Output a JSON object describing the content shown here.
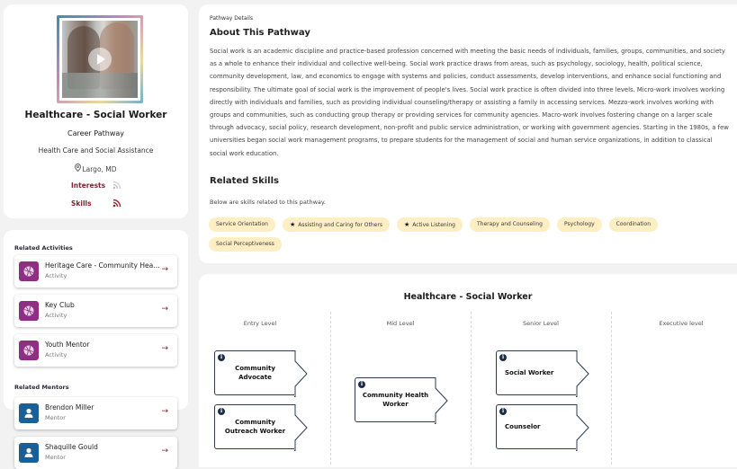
{
  "profile": {
    "photo_alt": "video thumbnail with play button",
    "title": "Healthcare - Social Worker",
    "subtitle": "Career Pathway",
    "industry": "Health Care and Social Assistance",
    "location": "Largo, MD",
    "interests_label": "Interests",
    "skills_label": "Skills",
    "accent_color": "#7b2430"
  },
  "related_activities": {
    "heading": "Related Activities",
    "items": [
      {
        "title": "Heritage Care - Community Heal...",
        "type": "Activity",
        "icon": "basketball-icon"
      },
      {
        "title": "Key Club",
        "type": "Activity",
        "icon": "basketball-icon"
      },
      {
        "title": "Youth Mentor",
        "type": "Activity",
        "icon": "basketball-icon"
      }
    ],
    "icon_color": "#8e2f84"
  },
  "related_mentors": {
    "heading": "Related Mentors",
    "items": [
      {
        "name": "Brendon Miller",
        "role": "Mentor",
        "icon": "person-icon"
      },
      {
        "name": "Shaquille Gould",
        "role": "Mentor",
        "icon": "person-icon"
      }
    ],
    "icon_color": "#1a5f96"
  },
  "about": {
    "label": "Pathway Details",
    "title": "About This Pathway",
    "text": "Social work is an academic discipline and practice-based profession concerned with meeting the basic needs of individuals, families, groups, communities, and society as a whole to enhance their individual and collective well-being. Social work practice draws from areas, such as psychology, sociology, health, political science, community development, law, and economics to engage with systems and policies, conduct assessments, develop interventions, and enhance social functioning and responsibility. The ultimate goal of social work is the improvement of people's lives. Social work practice is often divided into three levels. Micro-work involves working directly with individuals and families, such as providing individual counseling/therapy or assisting a family in accessing services. Mezzo-work involves working with groups and communities, such as conducting group therapy or providing services for community agencies. Macro-work involves fostering change on a larger scale through advocacy, social policy, research development, non-profit and public service administration, or working with government agencies. Starting in the 1980s, a few universities began social work management programs, to prepare students for the management of social and human service organizations, in addition to classical social work education."
  },
  "skills": {
    "title": "Related Skills",
    "description": "Below are skills related to this pathway.",
    "chips": [
      {
        "label": "Service Orientation",
        "starred": false
      },
      {
        "label": "Assisting and Caring for Others",
        "starred": true
      },
      {
        "label": "Active Listening",
        "starred": true
      },
      {
        "label": "Therapy and Counseling",
        "starred": false
      },
      {
        "label": "Psychology",
        "starred": false
      },
      {
        "label": "Coordination",
        "starred": false
      },
      {
        "label": "Social Perceptiveness",
        "starred": false
      }
    ],
    "chip_color": "#fdeec4"
  },
  "pathway": {
    "title": "Healthcare - Social Worker",
    "levels": [
      {
        "label": "Entry Level",
        "jobs": [
          "Community Advocate",
          "Community Outreach Worker"
        ]
      },
      {
        "label": "Mid Level",
        "jobs": [
          "Community Health Worker"
        ]
      },
      {
        "label": "Senior Level",
        "jobs": [
          "Social Worker",
          "Counselor"
        ]
      },
      {
        "label": "Executive level",
        "jobs": []
      }
    ],
    "info_icon": "info-icon"
  }
}
